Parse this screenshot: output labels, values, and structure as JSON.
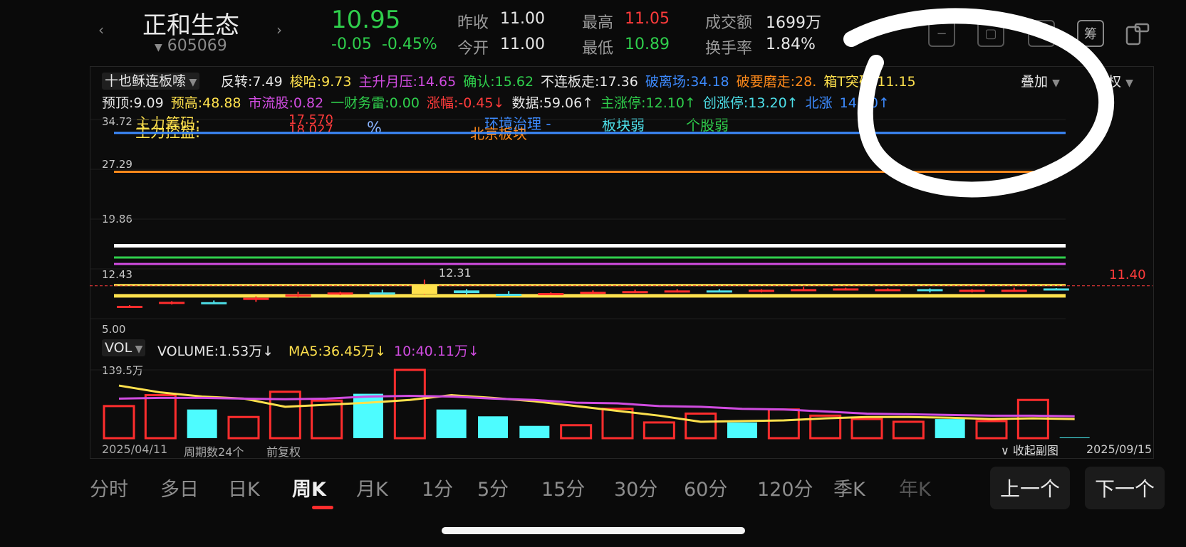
{
  "stock": {
    "name": "正和生态",
    "code": "605069",
    "price": "10.95",
    "change": "-0.05",
    "change_pct": "-0.45%"
  },
  "quote": {
    "prev_close_label": "昨收",
    "prev_close": "11.00",
    "open_label": "今开",
    "open": "11.00",
    "high_label": "最高",
    "high": "11.05",
    "low_label": "最低",
    "low": "10.89",
    "turnover_amt_label": "成交额",
    "turnover_amt": "1699万",
    "turnover_rate_label": "换手率",
    "turnover_rate": "1.84%"
  },
  "top_icons": {
    "icon3": "筹"
  },
  "indicator": {
    "name": "十也稣连板嗦",
    "row1": [
      {
        "label": "反转:7.49",
        "color": "#e6e6e6"
      },
      {
        "label": "梭哈:9.73",
        "color": "#ffe14d"
      },
      {
        "label": "主升月压:14.65",
        "color": "#d04ce0"
      },
      {
        "label": "确认:15.62",
        "color": "#2fcf4c"
      },
      {
        "label": "不连板走:17.36",
        "color": "#e6e6e6"
      },
      {
        "label": "破离场:34.18",
        "color": "#3d8bff"
      },
      {
        "label": "破要磨走:28.",
        "color": "#ff8a1a"
      },
      {
        "label": "箱T突破:11.15",
        "color": "#ffe14d"
      }
    ],
    "overlay": "叠加",
    "fuquan": "权",
    "row2": [
      {
        "label": "预顶:9.09",
        "color": "#e6e6e6"
      },
      {
        "label": "预高:48.88",
        "color": "#ffe14d"
      },
      {
        "label": "市流股:0.82",
        "color": "#d04ce0"
      },
      {
        "label": "一财务雷:0.00",
        "color": "#2fcf4c"
      },
      {
        "label": "涨幅:-0.45↓",
        "color": "#ff3b3b"
      },
      {
        "label": "数据:59.06↑",
        "color": "#e6e6e6"
      },
      {
        "label": "主涨停:12.10↑",
        "color": "#2fcf4c"
      },
      {
        "label": "创涨停:13.20↑",
        "color": "#4ddfe8"
      },
      {
        "label": "北涨",
        "color": "#3d8bff"
      },
      {
        "label": "14.30↑",
        "color": "#3d8bff"
      }
    ]
  },
  "overlay_texts": {
    "t1": "主力筹码:",
    "t2": "主力控盘:",
    "t3": "17.570",
    "t4": "18.027",
    "t5": "%",
    "t6": "环境治理 -",
    "t7": "北京板块",
    "t8": "板块弱",
    "t9": "个股弱"
  },
  "yaxis": {
    "y1": "34.72",
    "y2": "27.29",
    "y3": "19.86",
    "y4": "12.43",
    "y5": "5.00",
    "right": "11.40",
    "peak": "12.31"
  },
  "vol": {
    "name": "VOL",
    "volume": "VOLUME:1.53万↓",
    "ma5": "MA5:36.45万↓",
    "ma10": "10:40.11万↓",
    "ymax": "139.5万"
  },
  "footer": {
    "start": "2025/04/11",
    "periods": "周期数24个",
    "fq": "前复权",
    "collapse": "收起副图",
    "end": "2025/09/15"
  },
  "tabs": [
    "分时",
    "多日",
    "日K",
    "周K",
    "月K",
    "1分",
    "5分",
    "15分",
    "30分",
    "60分",
    "120分",
    "季K",
    "年K"
  ],
  "buttons": {
    "prev": "上一个",
    "next": "下一个"
  },
  "chart_data": {
    "type": "candlestick",
    "candles": [
      {
        "o": 8.2,
        "c": 8.4,
        "h": 8.5,
        "l": 8.1,
        "up": true
      },
      {
        "o": 8.7,
        "c": 9.0,
        "h": 9.1,
        "l": 8.6,
        "up": true
      },
      {
        "o": 8.9,
        "c": 8.95,
        "h": 9.2,
        "l": 8.7,
        "up": false
      },
      {
        "o": 9.3,
        "c": 9.6,
        "h": 9.8,
        "l": 9.0,
        "up": true
      },
      {
        "o": 9.8,
        "c": 10.1,
        "h": 10.5,
        "l": 9.7,
        "up": true
      },
      {
        "o": 10.1,
        "c": 10.4,
        "h": 10.5,
        "l": 10.0,
        "up": true
      },
      {
        "o": 10.4,
        "c": 10.3,
        "h": 10.8,
        "l": 10.1,
        "up": false
      },
      {
        "o": 10.2,
        "c": 11.6,
        "h": 12.31,
        "l": 10.1,
        "up": true
      },
      {
        "o": 10.7,
        "c": 10.3,
        "h": 10.9,
        "l": 10.1,
        "up": false
      },
      {
        "o": 10.2,
        "c": 10.1,
        "h": 10.6,
        "l": 9.9,
        "up": false
      },
      {
        "o": 10.1,
        "c": 10.3,
        "h": 10.4,
        "l": 10.0,
        "up": true
      },
      {
        "o": 10.3,
        "c": 10.5,
        "h": 10.7,
        "l": 10.2,
        "up": true
      },
      {
        "o": 10.4,
        "c": 10.6,
        "h": 10.8,
        "l": 10.3,
        "up": true
      },
      {
        "o": 10.5,
        "c": 10.7,
        "h": 10.9,
        "l": 10.4,
        "up": true
      },
      {
        "o": 10.7,
        "c": 10.6,
        "h": 10.9,
        "l": 10.5,
        "up": false
      },
      {
        "o": 10.5,
        "c": 10.8,
        "h": 10.9,
        "l": 10.4,
        "up": true
      },
      {
        "o": 10.8,
        "c": 10.9,
        "h": 11.2,
        "l": 10.7,
        "up": true
      },
      {
        "o": 10.8,
        "c": 11.0,
        "h": 11.1,
        "l": 10.7,
        "up": true
      },
      {
        "o": 10.9,
        "c": 10.9,
        "h": 11.0,
        "l": 10.8,
        "up": true
      },
      {
        "o": 10.9,
        "c": 10.6,
        "h": 11.0,
        "l": 10.4,
        "up": false
      },
      {
        "o": 10.6,
        "c": 10.8,
        "h": 10.9,
        "l": 10.4,
        "up": true
      },
      {
        "o": 10.6,
        "c": 10.8,
        "h": 11.1,
        "l": 10.5,
        "up": true
      },
      {
        "o": 11.0,
        "c": 10.95,
        "h": 11.05,
        "l": 10.89,
        "up": false
      }
    ],
    "volumes": [
      {
        "v": 47,
        "up": true
      },
      {
        "v": 63,
        "up": true
      },
      {
        "v": 42,
        "up": false
      },
      {
        "v": 31,
        "up": true
      },
      {
        "v": 68,
        "up": true
      },
      {
        "v": 55,
        "up": true
      },
      {
        "v": 65,
        "up": false
      },
      {
        "v": 100,
        "up": true
      },
      {
        "v": 42,
        "up": false
      },
      {
        "v": 32,
        "up": false
      },
      {
        "v": 18,
        "up": false
      },
      {
        "v": 19,
        "up": true
      },
      {
        "v": 43,
        "up": true
      },
      {
        "v": 23,
        "up": true
      },
      {
        "v": 36,
        "up": true
      },
      {
        "v": 23,
        "up": false
      },
      {
        "v": 42,
        "up": true
      },
      {
        "v": 33,
        "up": true
      },
      {
        "v": 28,
        "up": true
      },
      {
        "v": 24,
        "up": true
      },
      {
        "v": 28,
        "up": false
      },
      {
        "v": 25,
        "up": true
      },
      {
        "v": 56,
        "up": true
      },
      {
        "v": 1,
        "up": false
      }
    ],
    "ma5": [
      77,
      67,
      61,
      58,
      46,
      49,
      52,
      56,
      63,
      59,
      54,
      47,
      40,
      33,
      24,
      25,
      26,
      29,
      31,
      31,
      30,
      28,
      29,
      28
    ],
    "ma10": [
      58,
      59,
      59,
      58,
      57,
      58,
      61,
      62,
      61,
      58,
      56,
      52,
      51,
      47,
      46,
      43,
      42,
      39,
      36,
      35,
      34,
      33,
      33,
      32
    ],
    "flat_lines": [
      {
        "value": 34.2,
        "color": "#3d8bff"
      },
      {
        "value": 28.4,
        "color": "#ff8a1a"
      },
      {
        "value": 17.36,
        "color": "#ffffff"
      },
      {
        "value": 15.62,
        "color": "#2fcf4c"
      },
      {
        "value": 14.65,
        "color": "#d04ce0"
      }
    ],
    "price_range": [
      5.0,
      34.72
    ],
    "vol_max": 139.5
  }
}
